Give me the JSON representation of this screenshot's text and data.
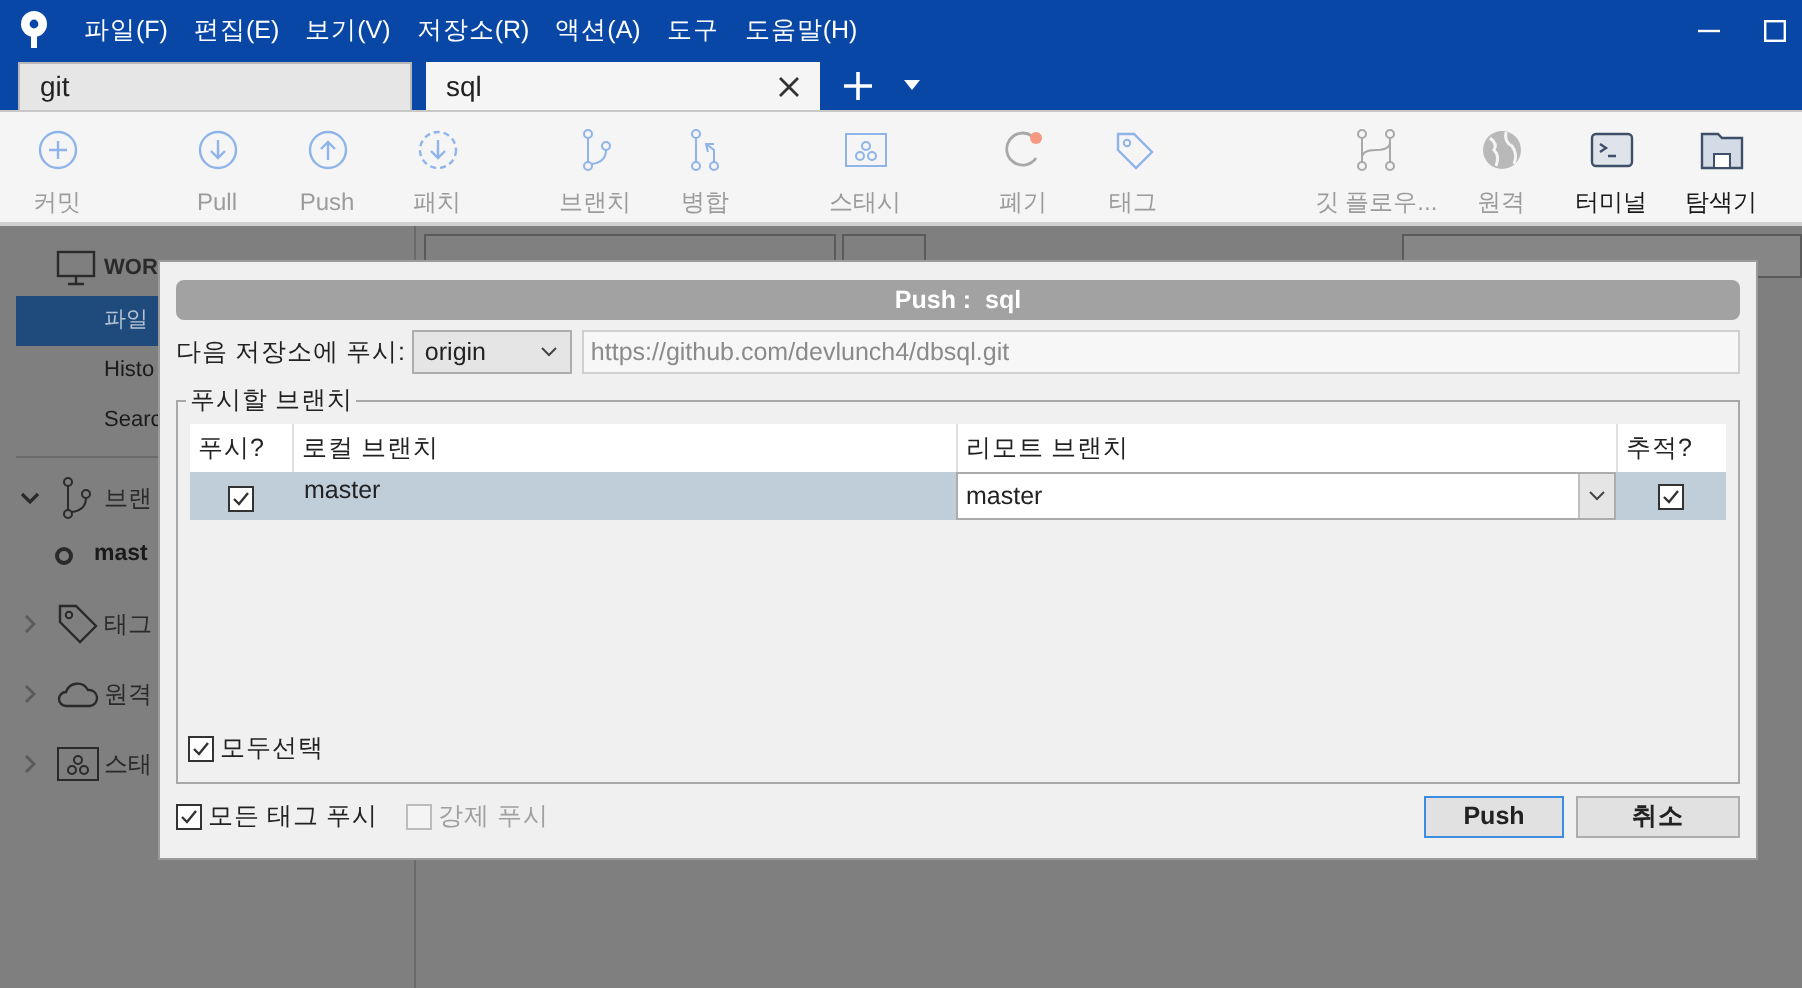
{
  "title_bar": {
    "menu": [
      "파일(F)",
      "편집(E)",
      "보기(V)",
      "저장소(R)",
      "액션(A)",
      "도구",
      "도움말(H)"
    ]
  },
  "tabs": [
    {
      "label": "git",
      "selected": false
    },
    {
      "label": "sql",
      "selected": true
    }
  ],
  "toolbar": [
    {
      "label": "커밋",
      "disabled": true
    },
    {
      "label": "Pull",
      "disabled": true
    },
    {
      "label": "Push",
      "disabled": true
    },
    {
      "label": "패치",
      "disabled": true
    },
    {
      "label": "브랜치",
      "disabled": true
    },
    {
      "label": "병합",
      "disabled": true
    },
    {
      "label": "스태시",
      "disabled": true
    },
    {
      "label": "폐기",
      "disabled": true
    },
    {
      "label": "태그",
      "disabled": true
    },
    {
      "label": "깃 플로우...",
      "disabled": true
    },
    {
      "label": "원격",
      "disabled": true
    },
    {
      "label": "터미널",
      "disabled": false
    },
    {
      "label": "탐색기",
      "disabled": false
    }
  ],
  "sidebar": {
    "workspace": "WOR",
    "items": [
      {
        "label": "파일",
        "selected": true
      },
      {
        "label": "Histo",
        "selected": false
      },
      {
        "label": "Searc",
        "selected": false
      }
    ],
    "sections": [
      {
        "label": "브랜",
        "expanded": true,
        "children": [
          {
            "label": "mast"
          }
        ]
      },
      {
        "label": "태그",
        "expanded": false
      },
      {
        "label": "원격",
        "expanded": false
      },
      {
        "label": "스태",
        "expanded": false
      }
    ]
  },
  "push_dialog": {
    "title": "Push :  sql",
    "remote_label": "다음 저장소에 푸시:",
    "remote": "origin",
    "remote_url": "https://github.com/devlunch4/dbsql.git",
    "group_title": "푸시할 브랜치",
    "columns": [
      "푸시?",
      "로컬 브랜치",
      "리모트 브랜치",
      "추적?"
    ],
    "rows": [
      {
        "push": true,
        "local": "master",
        "remote": "master",
        "track": true,
        "selected": true
      }
    ],
    "select_all": {
      "label": "모두선택",
      "checked": true
    },
    "options": [
      {
        "label": "모든 태그 푸시",
        "checked": true,
        "disabled": false
      },
      {
        "label": "강제 푸시",
        "checked": false,
        "disabled": true
      }
    ],
    "buttons": [
      {
        "label": "Push",
        "default": true
      },
      {
        "label": "취소",
        "default": false
      }
    ]
  }
}
